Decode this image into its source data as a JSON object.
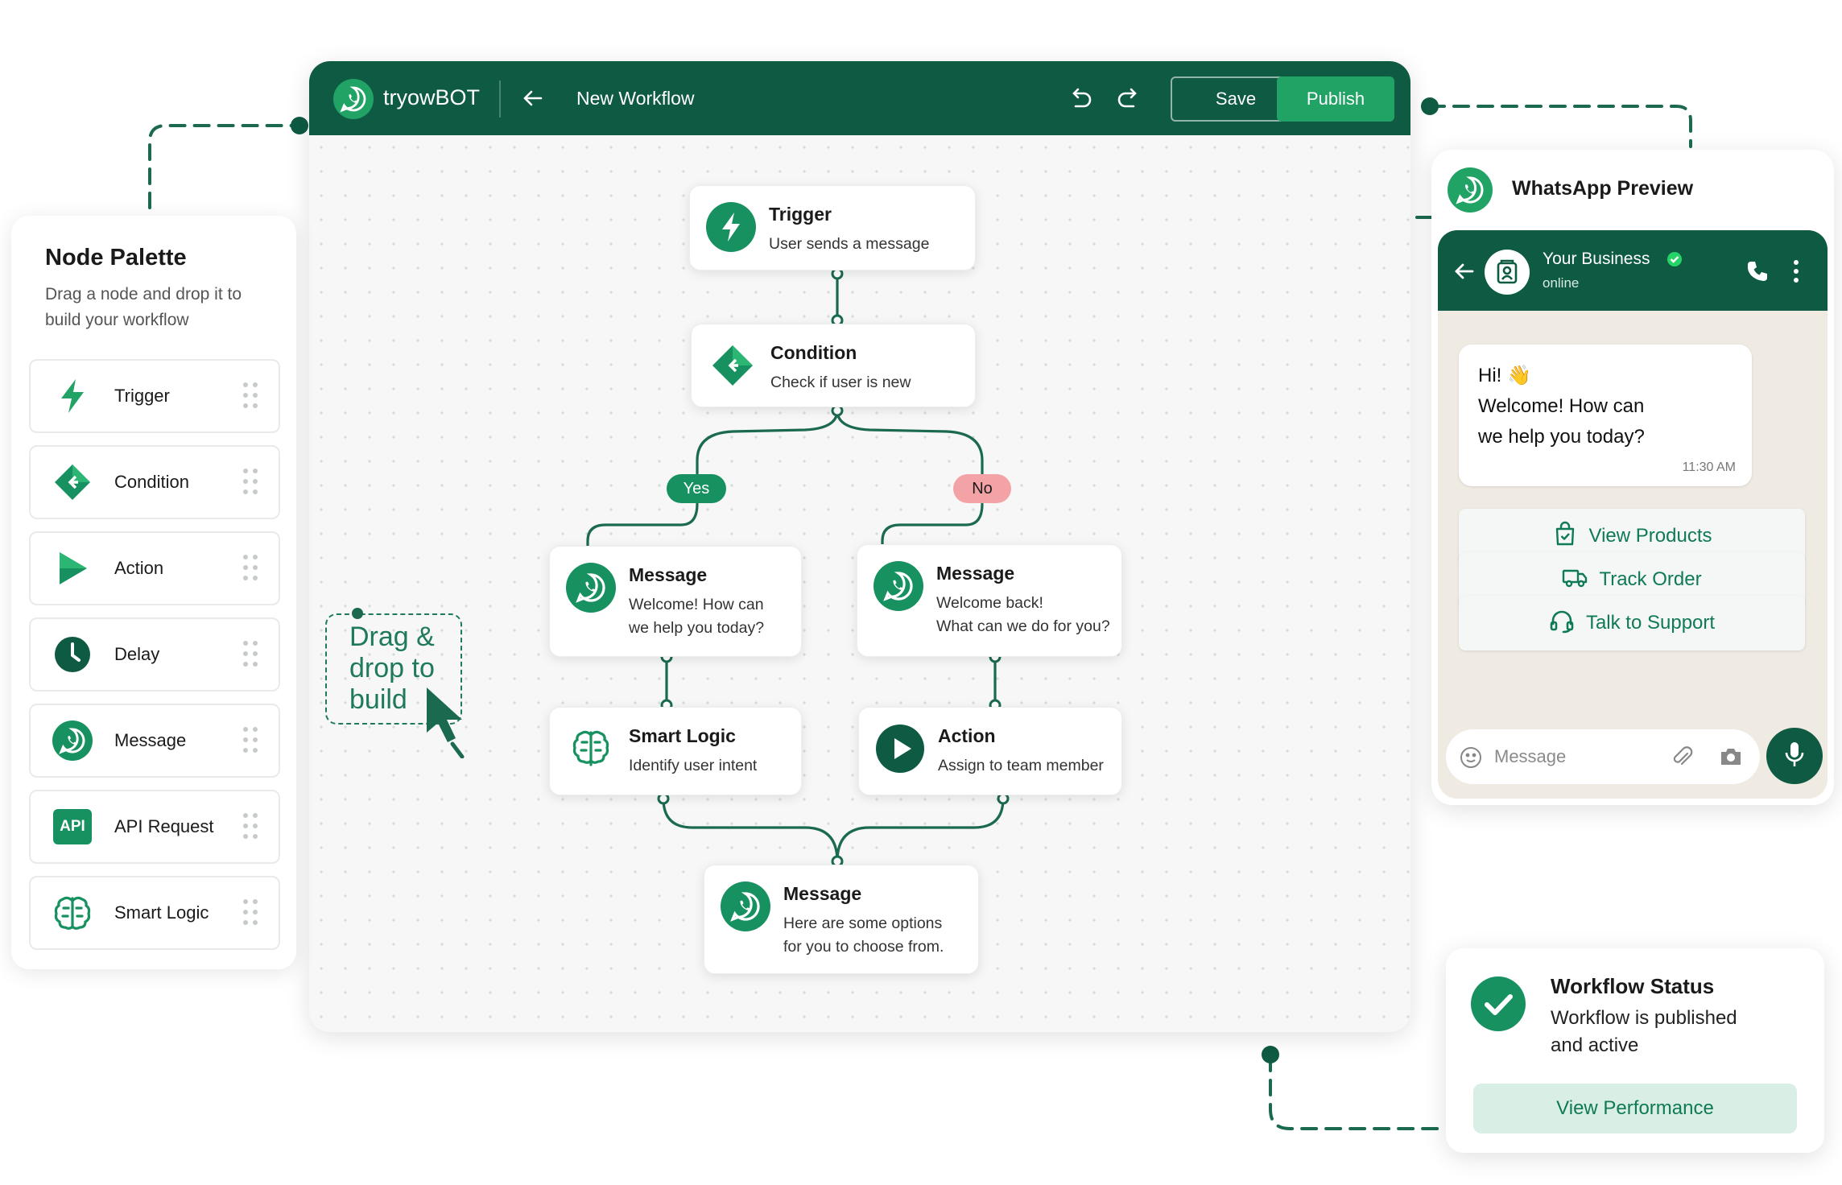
{
  "palette": {
    "title": "Node Palette",
    "subtitle": "Drag a node and drop it to build your workflow",
    "items": [
      {
        "label": "Trigger",
        "icon": "lightning-icon"
      },
      {
        "label": "Condition",
        "icon": "condition-diamond-icon"
      },
      {
        "label": "Action",
        "icon": "play-triangle-icon"
      },
      {
        "label": "Delay",
        "icon": "clock-icon"
      },
      {
        "label": "Message",
        "icon": "whatsapp-icon"
      },
      {
        "label": "API Request",
        "icon": "api-icon",
        "badge": "API"
      },
      {
        "label": "Smart Logic",
        "icon": "brain-icon"
      }
    ]
  },
  "editor": {
    "brand": "tryowBOT",
    "workflow_name": "New Workflow",
    "save_label": "Save",
    "publish_label": "Publish"
  },
  "flow": {
    "trigger": {
      "title": "Trigger",
      "desc": "User sends a message"
    },
    "condition": {
      "title": "Condition",
      "desc": "Check if user is new"
    },
    "yes_label": "Yes",
    "no_label": "No",
    "message_new": {
      "title": "Message",
      "line1": "Welcome! How can",
      "line2": "we help you today?"
    },
    "message_back": {
      "title": "Message",
      "line1": "Welcome back!",
      "line2": "What can we do for you?"
    },
    "smart_logic": {
      "title": "Smart Logic",
      "desc": "Identify user intent"
    },
    "action": {
      "title": "Action",
      "desc": "Assign to team member"
    },
    "message_options": {
      "title": "Message",
      "line1": "Here are some options",
      "line2": "for you to choose from."
    }
  },
  "drag_hint": {
    "line1": "Drag &",
    "line2": "drop to",
    "line3": "build"
  },
  "whatsapp": {
    "title": "WhatsApp Preview",
    "contact_name": "Your Business",
    "contact_status": "online",
    "bubble": {
      "greeting": "Hi! 👋",
      "line1": "Welcome! How can",
      "line2": "we help you today?",
      "time": "11:30 AM"
    },
    "quick_replies": [
      {
        "label": "View Products",
        "icon": "shopping-bag-icon"
      },
      {
        "label": "Track Order",
        "icon": "truck-icon"
      },
      {
        "label": "Talk to Support",
        "icon": "headset-icon"
      }
    ],
    "input_placeholder": "Message"
  },
  "status": {
    "title": "Workflow Status",
    "line1": "Workflow is published",
    "line2": "and active",
    "button_label": "View Performance"
  },
  "colors": {
    "brand_dark": "#0e5a43",
    "brand_green": "#21a366",
    "accent_green": "#17915f",
    "no_pill": "#f3a3a6",
    "soft_green": "#d9efe5"
  }
}
